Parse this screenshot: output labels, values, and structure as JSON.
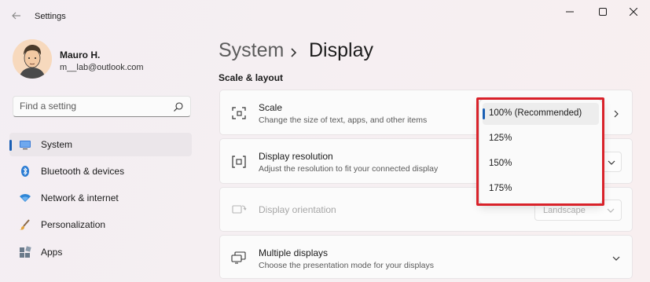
{
  "window": {
    "app_title": "Settings",
    "icons": {
      "back": "back-arrow-icon",
      "minimize": "minimize-icon",
      "maximize": "maximize-icon",
      "close": "close-icon"
    }
  },
  "user": {
    "name": "Mauro H.",
    "email": "m__lab@outlook.com",
    "avatar_icon": "user-avatar"
  },
  "search": {
    "placeholder": "Find a setting",
    "icon": "search-icon"
  },
  "sidebar": {
    "items": [
      {
        "label": "System",
        "icon": "system-display-icon",
        "active": true
      },
      {
        "label": "Bluetooth & devices",
        "icon": "bluetooth-icon",
        "active": false
      },
      {
        "label": "Network & internet",
        "icon": "wifi-icon",
        "active": false
      },
      {
        "label": "Personalization",
        "icon": "brush-icon",
        "active": false
      },
      {
        "label": "Apps",
        "icon": "apps-icon",
        "active": false
      }
    ]
  },
  "main": {
    "breadcrumb": {
      "root": "System",
      "current": "Display"
    },
    "section_title": "Scale & layout",
    "cards": [
      {
        "title": "Scale",
        "subtitle": "Change the size of text, apps, and other items",
        "icon": "scale-icon"
      },
      {
        "title": "Display resolution",
        "subtitle": "Adjust the resolution to fit your connected display",
        "icon": "resolution-icon"
      },
      {
        "title": "Display orientation",
        "subtitle": "",
        "icon": "orientation-icon",
        "value": "Landscape",
        "disabled": true
      },
      {
        "title": "Multiple displays",
        "subtitle": "Choose the presentation mode for your displays",
        "icon": "multiple-displays-icon"
      }
    ]
  },
  "scale_dropdown": {
    "options": [
      {
        "label": "100% (Recommended)",
        "selected": true
      },
      {
        "label": "125%",
        "selected": false
      },
      {
        "label": "150%",
        "selected": false
      },
      {
        "label": "175%",
        "selected": false
      }
    ],
    "highlight_color": "#d9222a"
  },
  "colors": {
    "accent": "#1a5fb4",
    "highlight": "#d9222a"
  }
}
